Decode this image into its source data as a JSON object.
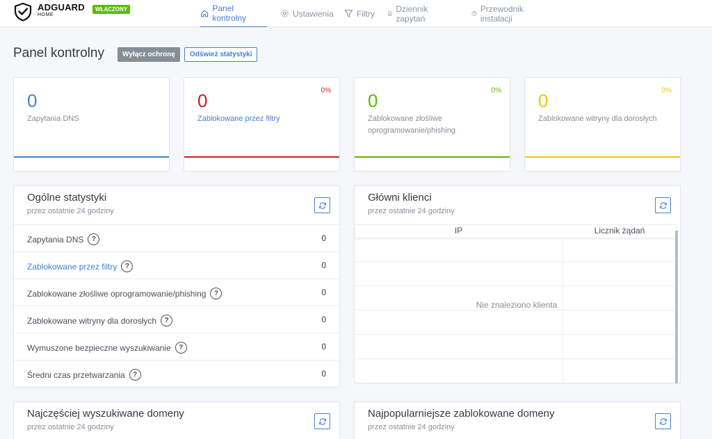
{
  "header": {
    "brand": "ADGUARD",
    "brand_sub": "HOME",
    "status_badge": "WŁĄCZONY",
    "nav": [
      {
        "label": "Panel kontrolny",
        "icon": "home-icon",
        "active": true
      },
      {
        "label": "Ustawienia",
        "icon": "gear-icon",
        "active": false
      },
      {
        "label": "Filtry",
        "icon": "filter-icon",
        "active": false
      },
      {
        "label": "Dziennik zapytań",
        "icon": "document-icon",
        "active": false
      },
      {
        "label": "Przewodnik instalacji",
        "icon": "help-circle-icon",
        "active": false
      }
    ]
  },
  "page": {
    "title": "Panel kontrolny",
    "disable_button": "Wyłącz ochronę",
    "refresh_button": "Odśwież statystyki"
  },
  "stat_cards": [
    {
      "value": "0",
      "label": "Zapytania DNS",
      "percent": "",
      "color": "#467fcf",
      "label_color": "#868e96"
    },
    {
      "value": "0",
      "label": "Zablokowane przez filtry",
      "percent": "0%",
      "color": "#cd201f",
      "label_color": "#467fcf"
    },
    {
      "value": "0",
      "label": "Zablokowane złośliwe oprogramowanie/phishing",
      "percent": "0%",
      "color": "#5eba00",
      "label_color": "#868e96"
    },
    {
      "value": "0",
      "label": "Zablokowane witryny dla dorosłych",
      "percent": "0%",
      "color": "#f1c40f",
      "label_color": "#868e96"
    }
  ],
  "general_stats": {
    "title": "Ogólne statystyki",
    "subtitle": "przez ostatnie 24 godziny",
    "rows": [
      {
        "label": "Zapytania DNS",
        "value": "0"
      },
      {
        "label": "Zablokowane przez filtry",
        "value": "0"
      },
      {
        "label": "Zablokowane złośliwe oprogramowanie/phishing",
        "value": "0"
      },
      {
        "label": "Zablokowane witryny dla dorosłych",
        "value": "0"
      },
      {
        "label": "Wymuszone bezpieczne wyszukiwanie",
        "value": "0"
      },
      {
        "label": "Średni czas przetwarzania",
        "value": "0"
      }
    ]
  },
  "top_clients": {
    "title": "Główni klienci",
    "subtitle": "przez ostatnie 24 godziny",
    "col_ip": "IP",
    "col_count": "Licznik żądań",
    "empty": "Nie znaleziono klienta"
  },
  "top_queried": {
    "title": "Najczęściej wyszukiwane domeny",
    "subtitle": "przez ostatnie 24 godziny"
  },
  "top_blocked": {
    "title": "Najpopularniejsze zablokowane domeny",
    "subtitle": "przez ostatnie 24 godziny"
  },
  "colors": {
    "accent": "#467fcf",
    "danger": "#cd201f",
    "success": "#5eba00",
    "warning": "#f1c40f"
  }
}
